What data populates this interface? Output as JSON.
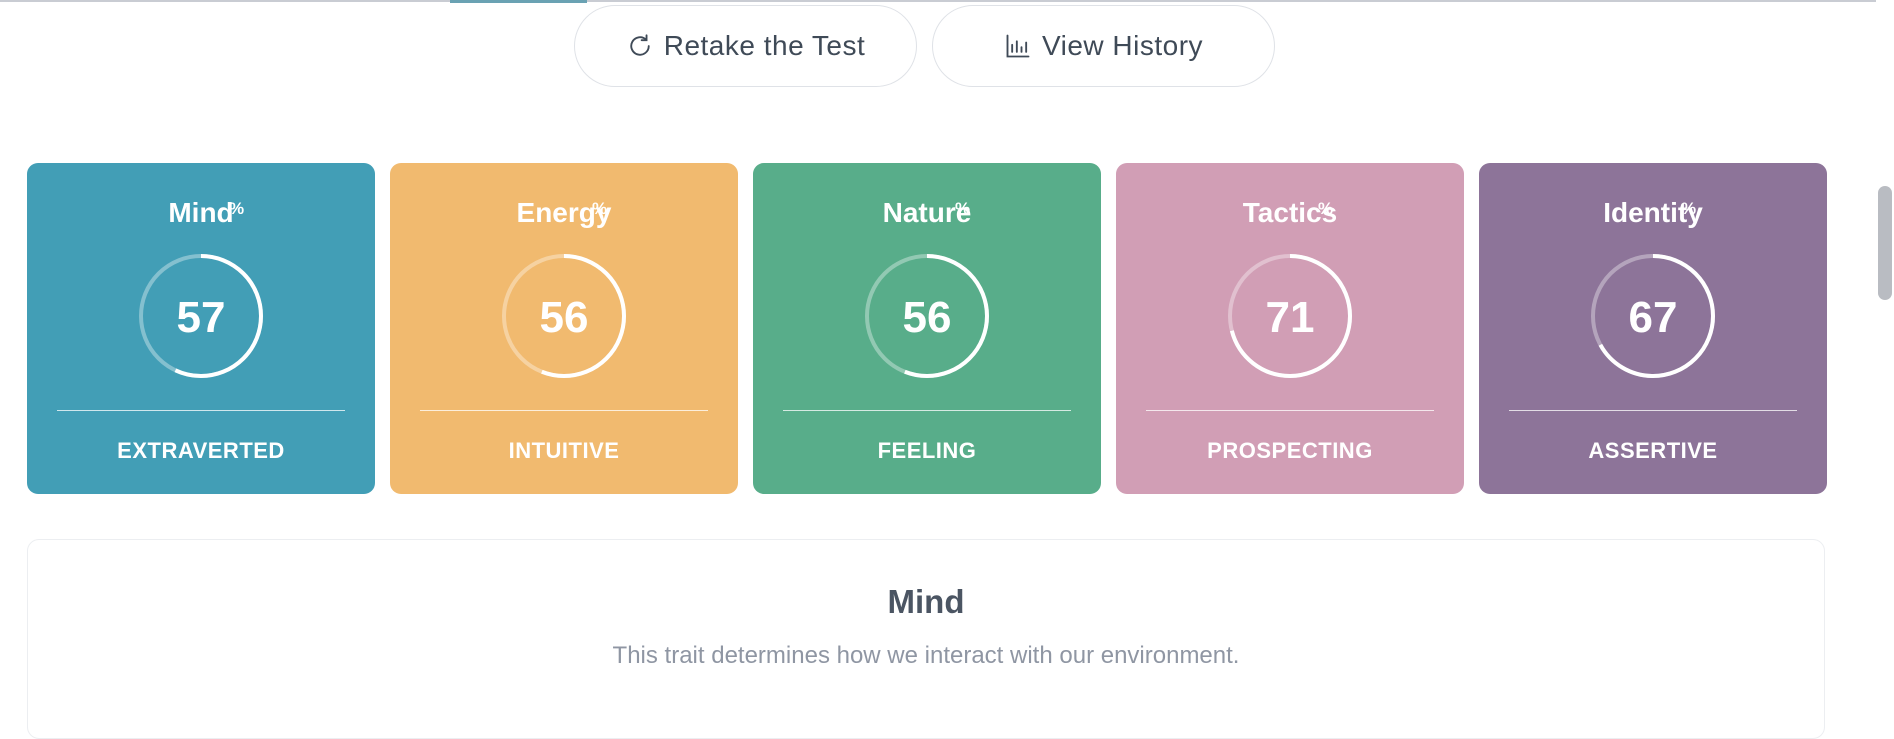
{
  "actions": {
    "retake": {
      "label": "Retake the Test",
      "icon": "refresh-icon"
    },
    "history": {
      "label": "View History",
      "icon": "bar-chart-icon"
    }
  },
  "traits": [
    {
      "name": "Mind",
      "percent": 57,
      "percent_sign": "%",
      "label": "EXTRAVERTED",
      "color": "#429EB6"
    },
    {
      "name": "Energy",
      "percent": 56,
      "percent_sign": "%",
      "label": "INTUITIVE",
      "color": "#F1BA6F"
    },
    {
      "name": "Nature",
      "percent": 56,
      "percent_sign": "%",
      "label": "FEELING",
      "color": "#58AD8A"
    },
    {
      "name": "Tactics",
      "percent": 71,
      "percent_sign": "%",
      "label": "PROSPECTING",
      "color": "#D19EB5"
    },
    {
      "name": "Identity",
      "percent": 67,
      "percent_sign": "%",
      "label": "ASSERTIVE",
      "color": "#8D7499"
    }
  ],
  "detail": {
    "title": "Mind",
    "description": "This trait determines how we interact with our environment."
  }
}
